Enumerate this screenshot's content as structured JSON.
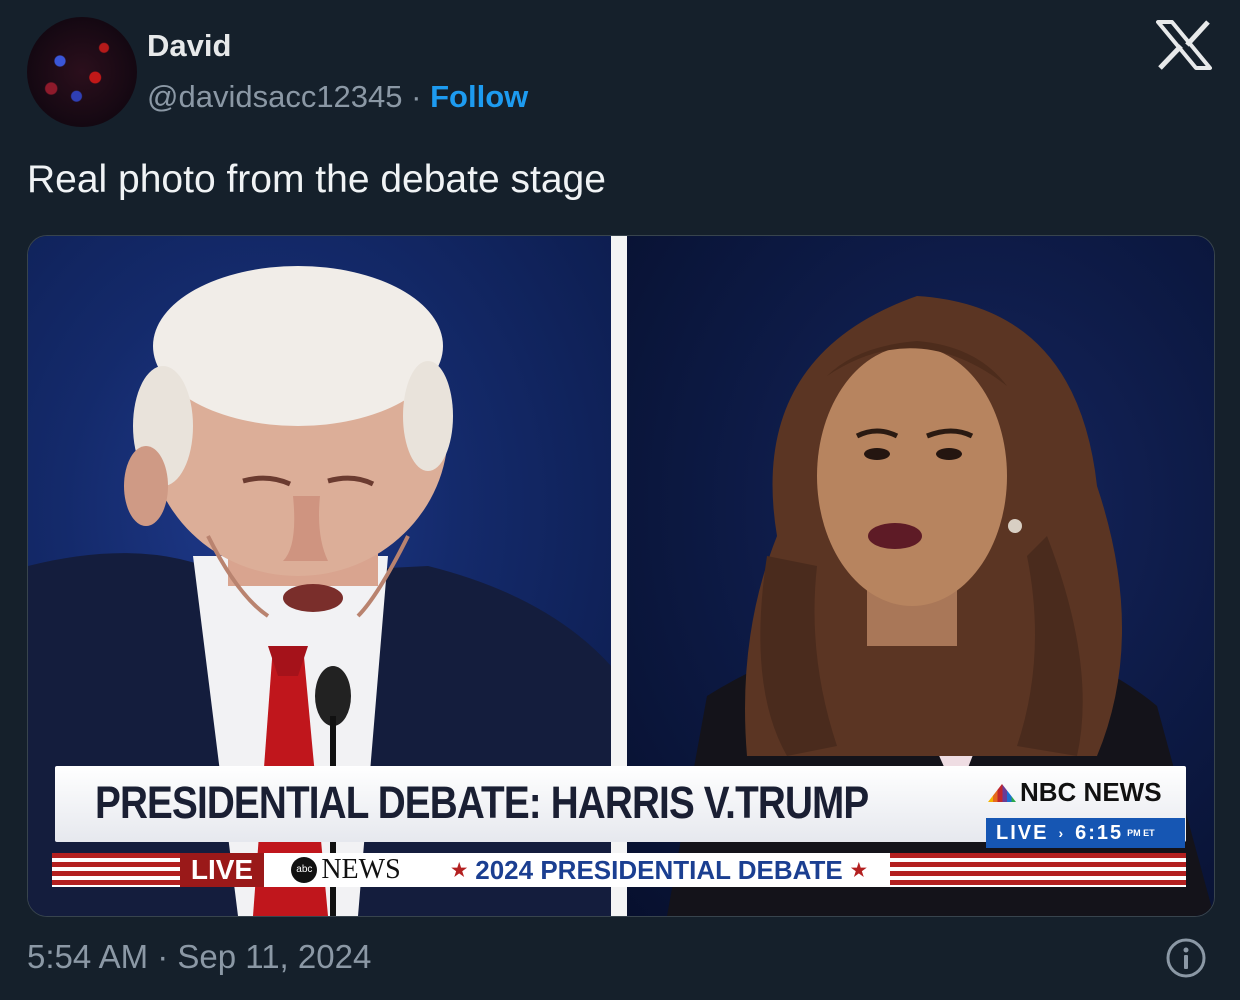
{
  "author": {
    "name": "David",
    "handle": "@davidsacc12345",
    "separator": "·",
    "follow_label": "Follow",
    "avatar_icon": "avatar-image"
  },
  "brand_icon": "x-logo-icon",
  "tweet": {
    "text": "Real photo from the debate stage"
  },
  "media": {
    "lower_third_title": "PRESIDENTIAL DEBATE: HARRIS V.TRUMP",
    "network_logo": "NBC NEWS",
    "live_label": "LIVE",
    "live_arrow": "›",
    "live_time": "6:15",
    "live_ampm": "PM ET",
    "ticker_live": "LIVE",
    "ticker_abc_circle": "abc",
    "ticker_network": "NEWS",
    "ticker_star": "★",
    "ticker_text": "2024 PRESIDENTIAL DEBATE"
  },
  "footer": {
    "timestamp": "5:54 AM · Sep 11, 2024",
    "info_icon": "info-icon"
  },
  "colors": {
    "background": "#15202b",
    "text": "#e7e9ea",
    "secondary_text": "#8b98a5",
    "accent": "#1d9bf0"
  }
}
